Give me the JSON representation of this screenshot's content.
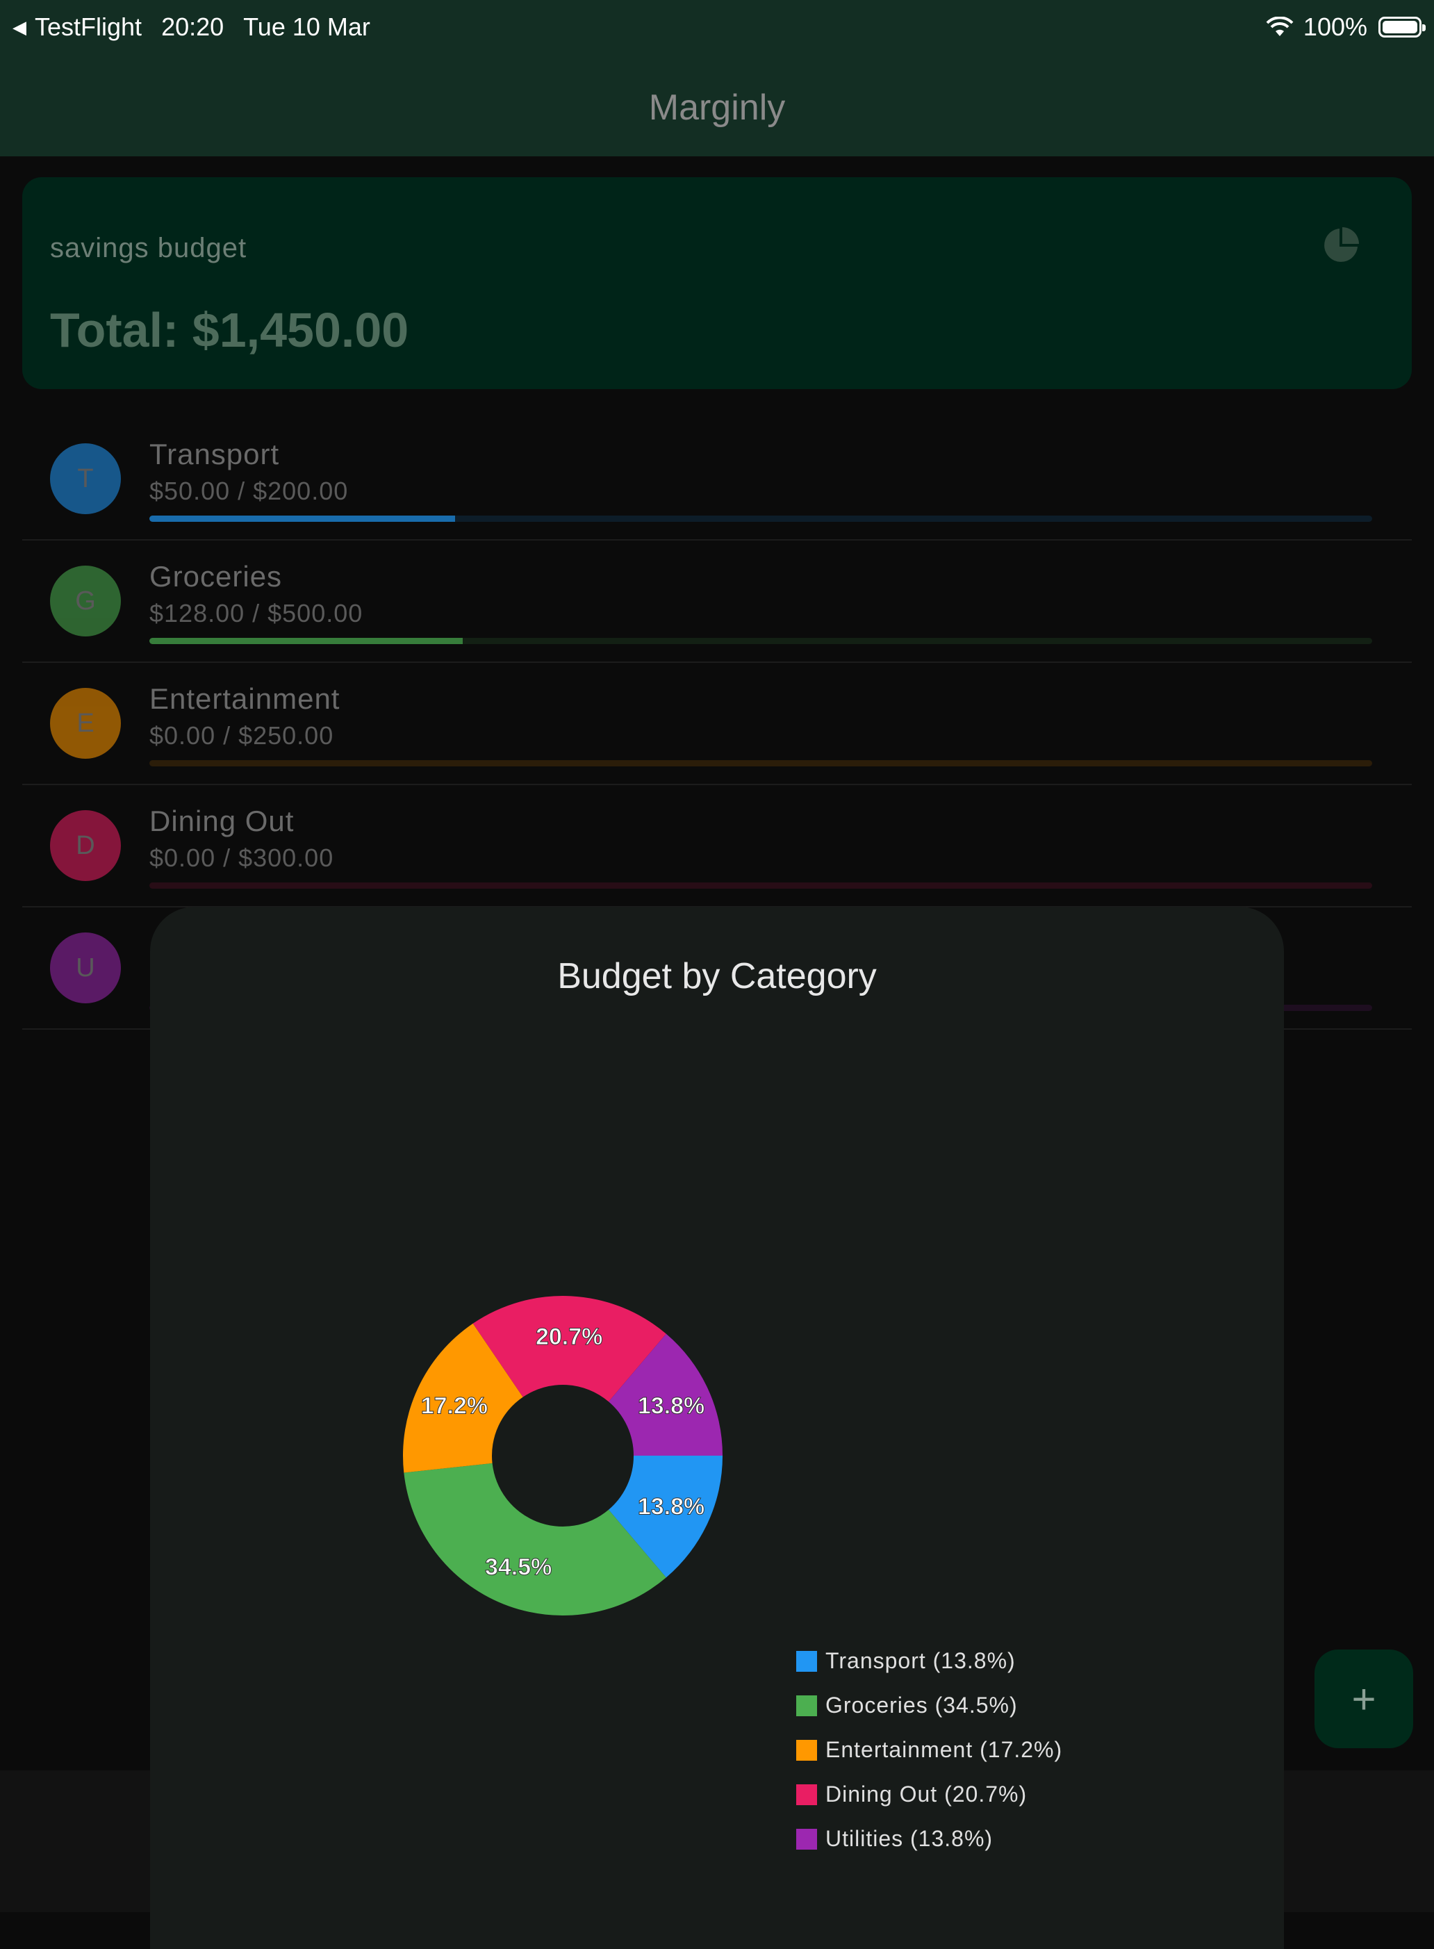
{
  "status_bar": {
    "back_app": "TestFlight",
    "time": "20:20",
    "date": "Tue 10 Mar",
    "battery": "100%"
  },
  "app_bar": {
    "title": "Marginly"
  },
  "summary": {
    "budget_name": "savings budget",
    "total": "Total: $1,450.00",
    "chart_icon": "pie-chart-icon"
  },
  "categories": [
    {
      "initial": "T",
      "name": "Transport",
      "amount": "$50.00 / $200.00",
      "progress": 0.25,
      "color": "#2196F3"
    },
    {
      "initial": "G",
      "name": "Groceries",
      "amount": "$128.00 / $500.00",
      "progress": 0.256,
      "color": "#4CAF50"
    },
    {
      "initial": "E",
      "name": "Entertainment",
      "amount": "$0.00 / $250.00",
      "progress": 0,
      "color": "#FF9800"
    },
    {
      "initial": "D",
      "name": "Dining Out",
      "amount": "$0.00 / $300.00",
      "progress": 0,
      "color": "#E91E63"
    },
    {
      "initial": "U",
      "name": "",
      "amount": "",
      "progress": 0,
      "color": "#9C27B0"
    }
  ],
  "fab": {
    "label": "+"
  },
  "sheet": {
    "title": "Budget by Category",
    "chart_data": {
      "type": "pie",
      "title": "Budget by Category",
      "donut": true,
      "categories": [
        "Transport",
        "Groceries",
        "Entertainment",
        "Dining Out",
        "Utilities"
      ],
      "values": [
        13.8,
        34.5,
        17.2,
        20.7,
        13.8
      ],
      "slice_labels": [
        "13.8%",
        "34.5%",
        "17.2%",
        "20.7%",
        "13.8%"
      ],
      "colors": [
        "#2196F3",
        "#4CAF50",
        "#FF9800",
        "#E91E63",
        "#9C27B0"
      ],
      "legend": [
        "Transport (13.8%)",
        "Groceries (34.5%)",
        "Entertainment (17.2%)",
        "Dining Out (20.7%)",
        "Utilities (13.8%)"
      ],
      "legend_position": "bottom-right"
    }
  }
}
